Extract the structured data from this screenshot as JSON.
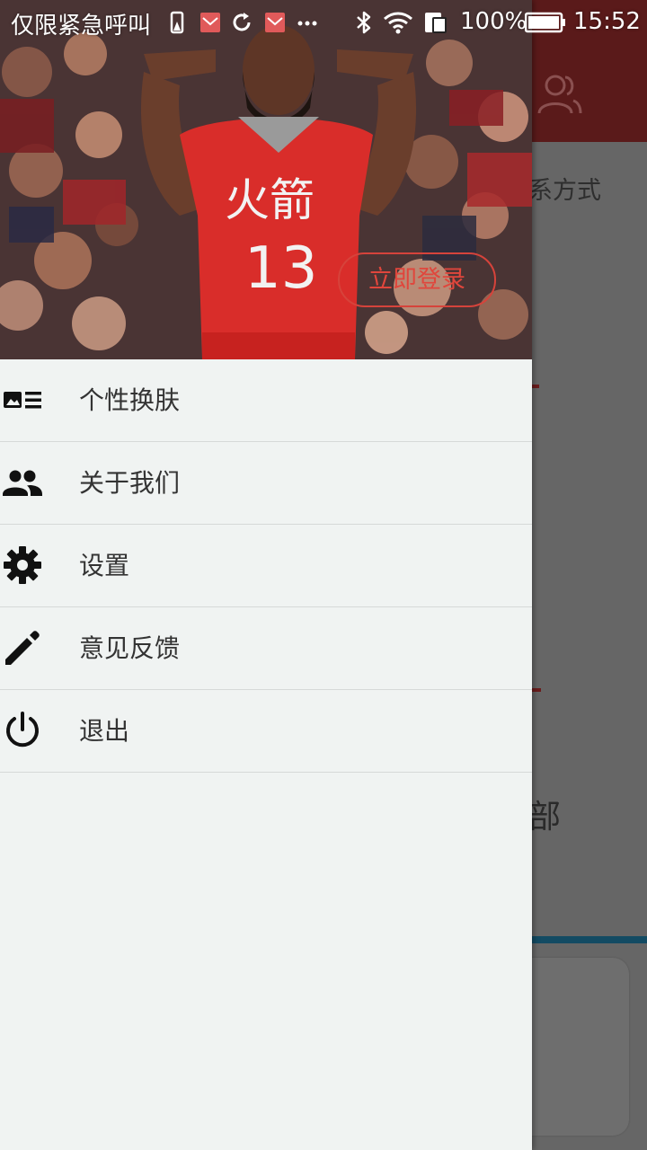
{
  "status_bar": {
    "carrier_text": "仅限紧急呼叫",
    "battery_percent": "100%",
    "time": "15:52"
  },
  "background": {
    "partial_text_top": "系方式",
    "partial_text_bottom": "部"
  },
  "drawer": {
    "header": {
      "jersey_team": "火箭",
      "jersey_number": "13",
      "login_button_label": "立即登录"
    },
    "menu_items": [
      {
        "label": "个性换肤",
        "icon": "skin-icon"
      },
      {
        "label": "关于我们",
        "icon": "people-icon"
      },
      {
        "label": "设置",
        "icon": "gear-icon"
      },
      {
        "label": "意见反馈",
        "icon": "pencil-icon"
      },
      {
        "label": "退出",
        "icon": "power-icon"
      }
    ]
  },
  "colors": {
    "drawer_bg": "#f0f3f2",
    "login_accent": "#e0463c",
    "scrim": "#666666",
    "top_bar_dim": "#5a1a1a"
  }
}
